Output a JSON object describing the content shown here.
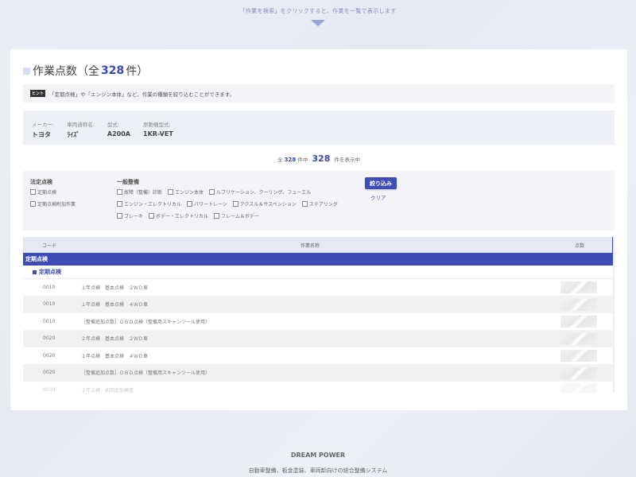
{
  "top_hint": "「作業を検索」をクリックすると、作業を一覧で表示します",
  "title": {
    "prefix": "作業点数（全",
    "count": "328",
    "suffix": "件）"
  },
  "hint": {
    "badge": "ヒント",
    "text": "「定期点検」や「エンジン本体」など、作業の種類を絞り込むことができます。"
  },
  "vehicle": [
    {
      "label": "メーカー:",
      "value": "トヨタ"
    },
    {
      "label": "車両通称名:",
      "value": "ﾗｲｽﾞ"
    },
    {
      "label": "型式:",
      "value": "A200A"
    },
    {
      "label": "原動機型式:",
      "value": "1KR-VET"
    }
  ],
  "showing": {
    "prefix": "全",
    "total": "328",
    "middle": "件中",
    "shown": "328",
    "suffix": "件を表示中"
  },
  "filters": {
    "group1": {
      "title": "法定点検",
      "options": [
        "定期点検",
        "定期点検附加作業"
      ]
    },
    "group2": {
      "title": "一般整備",
      "rows": [
        [
          "故障（整備）診断",
          "エンジン本体",
          "ルブリケーション、クーリング、フューエル"
        ],
        [
          "エンジン・エレクトリカル",
          "パワートレーン",
          "アクスル＆サスペンション",
          "ステアリング"
        ],
        [
          "ブレーキ",
          "ボデー・エレクトリカル",
          "フレーム＆ボデー"
        ]
      ]
    },
    "apply_label": "絞り込み",
    "clear_label": "クリア"
  },
  "table": {
    "headers": {
      "code": "コード",
      "name": "作業名称",
      "points": "点数"
    },
    "category": "定期点検",
    "subcategory": "定期点検",
    "rows": [
      {
        "code": "0010",
        "name": "１年点検　基本点検　２ＷＤ車"
      },
      {
        "code": "0010",
        "name": "１年点検　基本点検　４ＷＤ車"
      },
      {
        "code": "0010",
        "name": "［整備追加点数］ＯＢＤ点検（整備用スキャンツール使用）"
      },
      {
        "code": "0020",
        "name": "２年点検　基本点検　２ＷＤ車"
      },
      {
        "code": "0020",
        "name": "２年点検　基本点検　４ＷＤ車"
      },
      {
        "code": "0020",
        "name": "［整備追加点数］ＯＢＤ点検（整備用スキャンツール使用）"
      },
      {
        "code": "0030",
        "name": "２年点検　初回追加検査"
      }
    ]
  },
  "footer": {
    "brand": "DREAM POWER",
    "description": "自動車整備、板金塗装、車両卸向けの総合整備システム"
  }
}
